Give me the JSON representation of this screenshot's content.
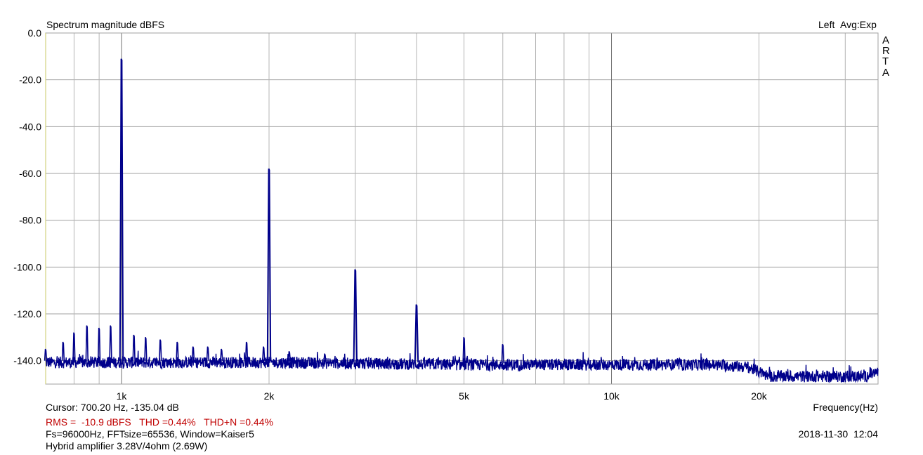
{
  "chart_data": {
    "type": "line",
    "title": "Spectrum magnitude dBFS",
    "channel": "Left",
    "averaging": "Avg:Exp",
    "brand_vertical": [
      "A",
      "R",
      "T",
      "A"
    ],
    "xlabel": "Frequency(Hz)",
    "xscale": "log",
    "xlim": [
      700,
      35000
    ],
    "ylim": [
      -150,
      0
    ],
    "grid": true,
    "y_ticks": [
      {
        "v": 0,
        "label": "0.0"
      },
      {
        "v": -20,
        "label": "-20.0"
      },
      {
        "v": -40,
        "label": "-40.0"
      },
      {
        "v": -60,
        "label": "-60.0"
      },
      {
        "v": -80,
        "label": "-80.0"
      },
      {
        "v": -100,
        "label": "-100.0"
      },
      {
        "v": -120,
        "label": "-120.0"
      },
      {
        "v": -140,
        "label": "-140.0"
      }
    ],
    "x_ticks": [
      {
        "v": 1000,
        "label": "1k"
      },
      {
        "v": 2000,
        "label": "2k"
      },
      {
        "v": 5000,
        "label": "5k"
      },
      {
        "v": 10000,
        "label": "10k"
      },
      {
        "v": 20000,
        "label": "20k"
      }
    ],
    "x_gridlines": [
      800,
      900,
      1000,
      2000,
      3000,
      4000,
      5000,
      6000,
      7000,
      8000,
      9000,
      10000,
      20000,
      30000
    ],
    "series": [
      {
        "color": "#00008b",
        "noise_floor": [
          {
            "x": 700,
            "y": -141
          },
          {
            "x": 2000,
            "y": -141
          },
          {
            "x": 5000,
            "y": -142
          },
          {
            "x": 10000,
            "y": -142
          },
          {
            "x": 16000,
            "y": -142
          },
          {
            "x": 19000,
            "y": -143
          },
          {
            "x": 21000,
            "y": -147
          },
          {
            "x": 25000,
            "y": -147
          },
          {
            "x": 33000,
            "y": -147
          },
          {
            "x": 35000,
            "y": -145
          }
        ],
        "peaks": [
          {
            "x": 700,
            "y": -135
          },
          {
            "x": 760,
            "y": -132
          },
          {
            "x": 800,
            "y": -128
          },
          {
            "x": 850,
            "y": -125
          },
          {
            "x": 900,
            "y": -126
          },
          {
            "x": 950,
            "y": -125
          },
          {
            "x": 1000,
            "y": -11
          },
          {
            "x": 1060,
            "y": -129
          },
          {
            "x": 1120,
            "y": -130
          },
          {
            "x": 1200,
            "y": -131
          },
          {
            "x": 1300,
            "y": -132
          },
          {
            "x": 1400,
            "y": -134
          },
          {
            "x": 1500,
            "y": -134
          },
          {
            "x": 1600,
            "y": -135
          },
          {
            "x": 1800,
            "y": -132
          },
          {
            "x": 1950,
            "y": -134
          },
          {
            "x": 2000,
            "y": -58
          },
          {
            "x": 2200,
            "y": -136
          },
          {
            "x": 2600,
            "y": -137
          },
          {
            "x": 3000,
            "y": -101
          },
          {
            "x": 4000,
            "y": -116
          },
          {
            "x": 5000,
            "y": -130
          },
          {
            "x": 6000,
            "y": -133
          }
        ]
      }
    ]
  },
  "info": {
    "cursor": "Cursor: 700.20 Hz, -135.04 dB",
    "rms": "RMS =  -10.9 dBFS   THD =0.44%   THD+N =0.44%",
    "fs": "Fs=96000Hz, FFTsize=65536, Window=Kaiser5",
    "description": "Hybrid amplifier 3.28V/4ohm (2.69W)",
    "timestamp": "2018-11-30  12:04"
  }
}
